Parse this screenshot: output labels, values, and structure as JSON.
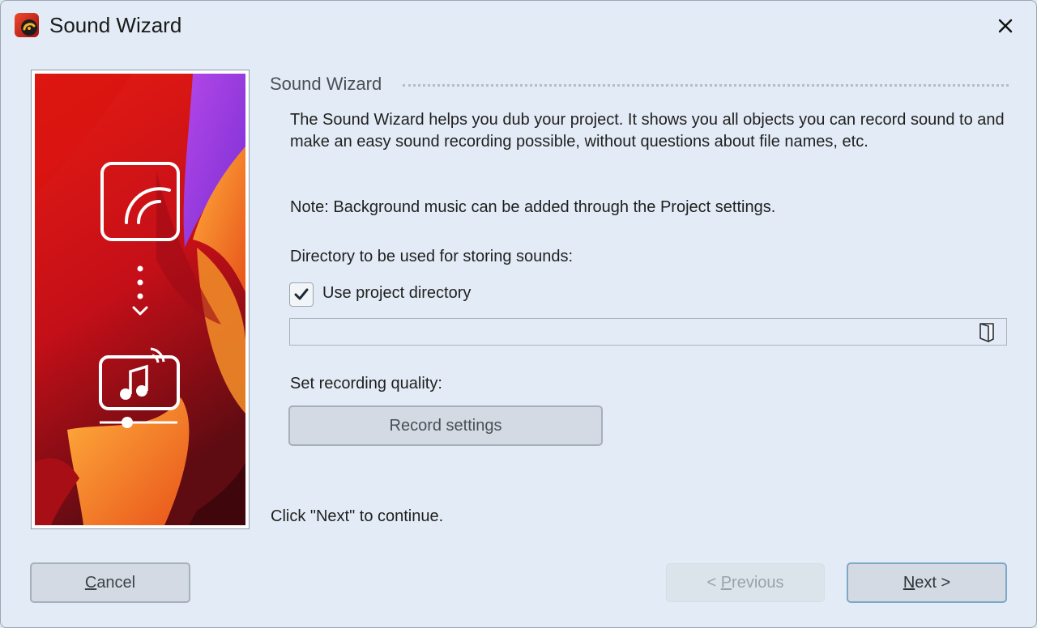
{
  "window": {
    "title": "Sound Wizard"
  },
  "section": {
    "title": "Sound Wizard"
  },
  "content": {
    "intro": "The Sound Wizard helps you dub your project. It shows you all objects you can record sound to and make an easy sound recording possible, without questions about file names, etc.",
    "note": "Note: Background music can be added through the Project settings.",
    "directory_label": "Directory to be used for storing sounds:",
    "use_project_directory": {
      "label": "Use project directory",
      "checked": true
    },
    "directory_value": "",
    "quality_label": "Set recording quality:",
    "record_settings_label": "Record settings",
    "continue_hint": "Click \"Next\" to continue."
  },
  "buttons": {
    "cancel": {
      "mnemonic": "C",
      "rest": "ancel"
    },
    "previous": {
      "prefix": "< ",
      "mnemonic": "P",
      "rest": "revious",
      "enabled": false
    },
    "next": {
      "mnemonic": "N",
      "rest": "ext >"
    }
  },
  "icons": {
    "app": "sound-wizard-app-icon",
    "close": "close-icon",
    "checkbox": "checkmark-icon",
    "folder": "folder-open-icon",
    "side_top": "speedometer-icon",
    "side_middle": "dotted-arrow-down-icon",
    "side_bottom": "music-mixer-icon"
  },
  "colors": {
    "window_bg": "#e3ecf6",
    "next_button_border": "#7fa7c6",
    "side_image_red": "#c8101a",
    "side_image_orange": "#f0962a",
    "side_image_purple": "#9c44e0"
  }
}
